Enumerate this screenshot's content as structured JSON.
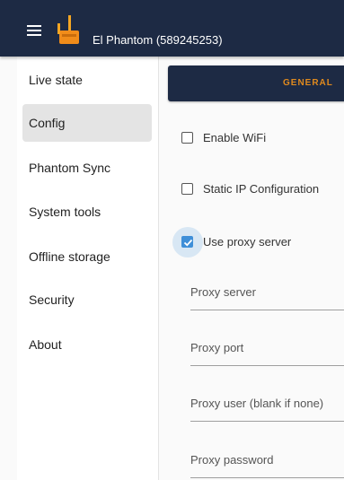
{
  "app": {
    "title": "El Phantom (589245253)",
    "brand_color": "#1d2a44",
    "accent_color": "#e08a1e",
    "logo_icon": "antenna-device-icon",
    "menu_icon": "hamburger-menu-icon"
  },
  "sidebar": {
    "items": [
      {
        "label": "Live state",
        "active": false
      },
      {
        "label": "Config",
        "active": true
      },
      {
        "label": "Phantom Sync",
        "active": false
      },
      {
        "label": "System tools",
        "active": false
      },
      {
        "label": "Offline storage",
        "active": false
      },
      {
        "label": "Security",
        "active": false
      },
      {
        "label": "About",
        "active": false
      }
    ]
  },
  "tabs": {
    "general_label": "GENERAL"
  },
  "form": {
    "enable_wifi": {
      "label": "Enable WiFi",
      "checked": false
    },
    "static_ip": {
      "label": "Static IP Configuration",
      "checked": false
    },
    "use_proxy": {
      "label": "Use proxy server",
      "checked": true
    },
    "proxy_server": {
      "label": "Proxy server",
      "value": ""
    },
    "proxy_port": {
      "label": "Proxy port",
      "value": ""
    },
    "proxy_user": {
      "label": "Proxy user (blank if none)",
      "value": ""
    },
    "proxy_password": {
      "label": "Proxy password",
      "value": ""
    }
  }
}
